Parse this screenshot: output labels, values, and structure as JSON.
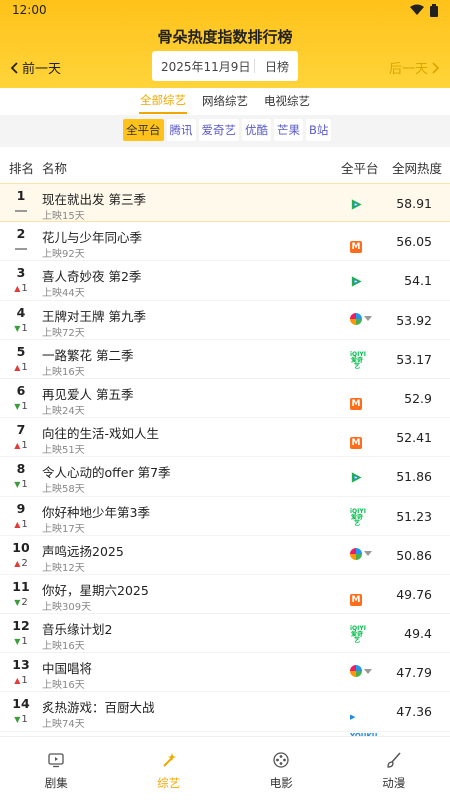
{
  "status": {
    "time": "12:00"
  },
  "header": {
    "title": "骨朵热度指数排行榜",
    "prev_label": "前一天",
    "next_label": "后一天",
    "date": "2025年11月9日",
    "period": "日榜"
  },
  "categories": [
    {
      "label": "全部综艺",
      "active": true
    },
    {
      "label": "网络综艺",
      "active": false
    },
    {
      "label": "电视综艺",
      "active": false
    }
  ],
  "platforms": [
    {
      "label": "全平台",
      "active": true
    },
    {
      "label": "腾讯",
      "active": false
    },
    {
      "label": "爱奇艺",
      "active": false
    },
    {
      "label": "优酷",
      "active": false
    },
    {
      "label": "芒果",
      "active": false
    },
    {
      "label": "B站",
      "active": false
    }
  ],
  "table": {
    "col_rank": "排名",
    "col_name": "名称",
    "col_platform": "全平台",
    "col_heat": "全网热度",
    "rows": [
      {
        "rank": "1",
        "change_dir": "same",
        "change": "",
        "name": "现在就出发 第三季",
        "days": "上映15天",
        "platform": "tencent-video-icon",
        "heat": "58.91"
      },
      {
        "rank": "2",
        "change_dir": "same",
        "change": "",
        "name": "花儿与少年同心季",
        "days": "上映92天",
        "platform": "mango-tv-icon",
        "heat": "56.05"
      },
      {
        "rank": "3",
        "change_dir": "up",
        "change": "1",
        "name": "喜人奇妙夜 第2季",
        "days": "上映44天",
        "platform": "tencent-video-icon",
        "heat": "54.1"
      },
      {
        "rank": "4",
        "change_dir": "down",
        "change": "1",
        "name": "王牌对王牌 第九季",
        "days": "上映72天",
        "platform": "multi-platform-icon",
        "heat": "53.92"
      },
      {
        "rank": "5",
        "change_dir": "up",
        "change": "1",
        "name": "一路繁花 第二季",
        "days": "上映16天",
        "platform": "iqiyi-icon",
        "heat": "53.17"
      },
      {
        "rank": "6",
        "change_dir": "down",
        "change": "1",
        "name": "再见爱人 第五季",
        "days": "上映24天",
        "platform": "mango-tv-icon",
        "heat": "52.9"
      },
      {
        "rank": "7",
        "change_dir": "up",
        "change": "1",
        "name": "向往的生活-戏如人生",
        "days": "上映51天",
        "platform": "mango-tv-icon",
        "heat": "52.41"
      },
      {
        "rank": "8",
        "change_dir": "down",
        "change": "1",
        "name": "令人心动的offer 第7季",
        "days": "上映58天",
        "platform": "tencent-video-icon",
        "heat": "51.86"
      },
      {
        "rank": "9",
        "change_dir": "up",
        "change": "1",
        "name": "你好种地少年第3季",
        "days": "上映17天",
        "platform": "iqiyi-icon",
        "heat": "51.23"
      },
      {
        "rank": "10",
        "change_dir": "up",
        "change": "2",
        "name": "声鸣远扬2025",
        "days": "上映12天",
        "platform": "multi-platform-icon",
        "heat": "50.86"
      },
      {
        "rank": "11",
        "change_dir": "down",
        "change": "2",
        "name": "你好，星期六2025",
        "days": "上映309天",
        "platform": "mango-tv-icon",
        "heat": "49.76"
      },
      {
        "rank": "12",
        "change_dir": "down",
        "change": "1",
        "name": "音乐缘计划2",
        "days": "上映16天",
        "platform": "iqiyi-icon",
        "heat": "49.4"
      },
      {
        "rank": "13",
        "change_dir": "up",
        "change": "1",
        "name": "中国唱将",
        "days": "上映16天",
        "platform": "multi-platform-icon",
        "heat": "47.79"
      },
      {
        "rank": "14",
        "change_dir": "down",
        "change": "1",
        "name": "炙热游戏：百厨大战",
        "days": "上映74天",
        "platform": "youku-icon",
        "heat": "47.36"
      }
    ]
  },
  "tabs": [
    {
      "label": "剧集",
      "icon": "tv-icon",
      "active": false
    },
    {
      "label": "综艺",
      "icon": "magic-wand-icon",
      "active": true
    },
    {
      "label": "电影",
      "icon": "film-reel-icon",
      "active": false
    },
    {
      "label": "动漫",
      "icon": "brush-icon",
      "active": false
    }
  ],
  "colors": {
    "accent": "#ffc21a",
    "up": "#e53935",
    "down": "#3a9d3a"
  }
}
